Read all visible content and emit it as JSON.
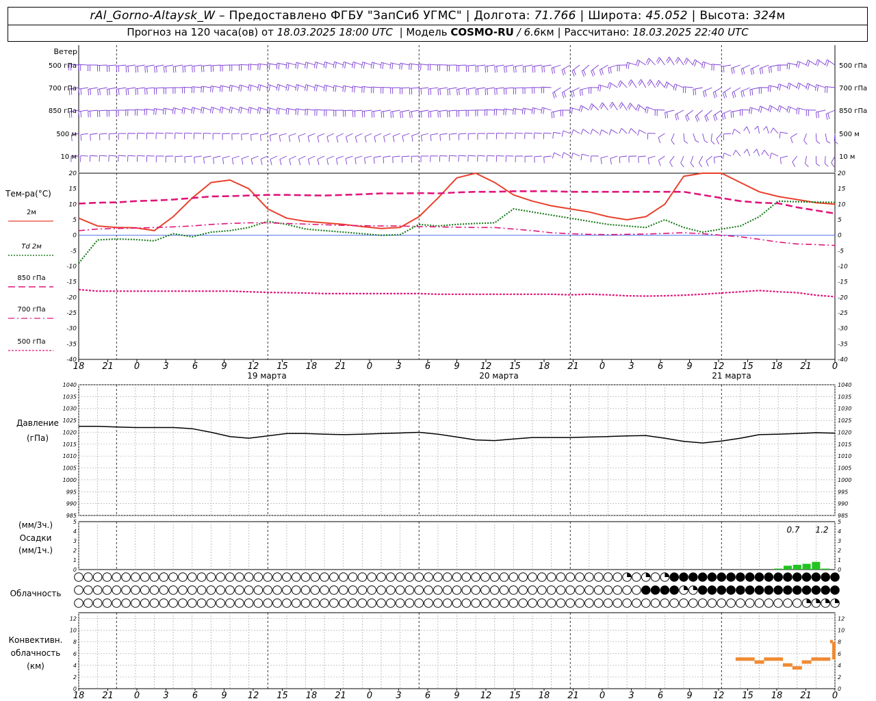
{
  "header": {
    "station": "rAl_Gorno-Altaysk_W",
    "dash": "–",
    "provider_label": "Предоставлено ФГБУ \"ЗапСиб УГМС\"",
    "lon_label": "Долгота:",
    "lon": "71.766",
    "lat_label": "Широта:",
    "lat": "45.052",
    "alt_label": "Высота:",
    "alt": "324",
    "alt_unit": "м",
    "sep": "|",
    "forecast_label": "Прогноз на 120 часа(ов) от",
    "forecast_time": "18.03.2025 18:00 UTC",
    "model_label": "Модель",
    "model_name": "COSMO-RU",
    "model_slash": "/",
    "model_res": "6.6",
    "model_res_unit": "км",
    "calc_label": "Рассчитано:",
    "calc_time": "18.03.2025 22:40 UTC"
  },
  "wind_panel": {
    "title": "Ветер",
    "levels": [
      "500 гПа",
      "700 гПа",
      "850 гПа",
      "500  м",
      "10  м"
    ]
  },
  "temp_panel": {
    "title": "Тем-ра(°C)",
    "legend": [
      {
        "label": "2м",
        "color": "#e8402a"
      },
      {
        "label": "Td  2м",
        "color": "#1a7a1a"
      },
      {
        "label": "850 гПа",
        "color": "#e0147a"
      },
      {
        "label": "700 гПа",
        "color": "#e0147a"
      },
      {
        "label": "500 гПа",
        "color": "#e0147a"
      }
    ]
  },
  "pressure_panel": {
    "title": "Давление",
    "unit": "(гПа)"
  },
  "precip_panel": {
    "unit_top": "(мм/3ч.)",
    "title": "Осадки",
    "unit_bottom": "(мм/1ч.)"
  },
  "cloud_panel": {
    "title": "Облачность"
  },
  "conv_panel": {
    "title_1": "Конвективн.",
    "title_2": "облачность",
    "unit": "(км)"
  },
  "time_axis": {
    "hour_labels": [
      "18",
      "21",
      "0",
      "3",
      "6",
      "9",
      "12",
      "15",
      "18",
      "21",
      "0",
      "3",
      "6",
      "9",
      "12",
      "15",
      "18",
      "21",
      "0",
      "3",
      "6",
      "9",
      "12",
      "15",
      "18",
      "21",
      "0"
    ],
    "day_labels": [
      "19 марта",
      "20 марта",
      "21 марта"
    ]
  },
  "chart_data": [
    {
      "type": "line",
      "title": "Тем-ра(°C)",
      "x_hours": [
        0,
        3,
        6,
        9,
        12,
        15,
        18,
        21,
        24,
        27,
        30,
        33,
        36,
        39,
        42,
        45,
        48,
        51,
        54,
        57,
        60,
        63,
        66,
        69,
        72,
        75,
        78,
        81,
        84,
        87,
        90,
        93,
        96,
        99,
        102,
        105,
        108,
        111,
        114,
        117,
        120
      ],
      "ylim": [
        -40,
        20
      ],
      "yticks": [
        20,
        15,
        10,
        5,
        0,
        -5,
        -10,
        -15,
        -20,
        -25,
        -30,
        -35,
        -40
      ],
      "series": [
        {
          "name": "2м",
          "color": "#e8402a",
          "values": [
            5.5,
            3,
            2.5,
            2.4,
            1.5,
            6,
            12,
            17,
            17.8,
            15,
            8.5,
            5.5,
            4.5,
            4,
            3.5,
            2.8,
            2.2,
            2.5,
            6,
            12,
            18.5,
            20.5,
            17,
            13,
            11,
            9.5,
            8.5,
            7.5,
            6,
            5,
            6,
            10,
            19,
            23,
            21,
            17,
            14,
            12.5,
            11.5,
            10.5,
            10
          ]
        },
        {
          "name": "Td  2м",
          "color": "#1a7a1a",
          "values": [
            -9,
            -1.5,
            -1.2,
            -1.4,
            -1.8,
            0.5,
            -0.5,
            1,
            1.5,
            2.5,
            4.5,
            3.5,
            2,
            1.5,
            1,
            0.5,
            0,
            0.2,
            3.5,
            3,
            3.5,
            3.8,
            4,
            8.5,
            7.5,
            6.5,
            5.5,
            4.5,
            3.5,
            3,
            2.5,
            5,
            2.5,
            1,
            2,
            3,
            6,
            11,
            10.8,
            10.7,
            10.6
          ]
        },
        {
          "name": "850 гПа",
          "color": "#e0147a",
          "values": [
            10.2,
            10.5,
            10.6,
            11,
            11.2,
            11.5,
            12,
            12.5,
            12.6,
            12.8,
            13,
            13,
            12.9,
            12.8,
            13,
            13.2,
            13.5,
            13.5,
            13.6,
            13.5,
            13.8,
            14,
            14,
            14.2,
            14.2,
            14.2,
            14,
            14,
            14,
            14,
            14,
            14,
            14,
            13,
            12,
            11,
            10.5,
            10.3,
            9,
            8,
            7
          ]
        },
        {
          "name": "700 гПа",
          "color": "#e0147a",
          "values": [
            1.5,
            2,
            2.2,
            2.3,
            2.5,
            2.7,
            3,
            3.5,
            3.8,
            4,
            4,
            3.8,
            3.6,
            3.4,
            3.2,
            3.1,
            3,
            3,
            2.8,
            2.7,
            2.6,
            2.5,
            2.5,
            2,
            1.5,
            0.8,
            0.5,
            0.3,
            0.2,
            0.3,
            0.4,
            0.6,
            0.8,
            0.5,
            0,
            -0.5,
            -1.3,
            -2.2,
            -2.8,
            -3,
            -3.3
          ]
        },
        {
          "name": "500 гПа",
          "color": "#e0147a",
          "values": [
            -17.5,
            -18,
            -18,
            -18,
            -18,
            -18,
            -18,
            -18,
            -18,
            -18.2,
            -18.4,
            -18.5,
            -18.6,
            -18.8,
            -18.8,
            -18.8,
            -18.8,
            -18.8,
            -18.8,
            -19,
            -19,
            -19,
            -19,
            -19,
            -19,
            -19,
            -19.2,
            -19,
            -19.2,
            -19.5,
            -19.6,
            -19.5,
            -19.3,
            -19,
            -18.6,
            -18.2,
            -17.8,
            -18.2,
            -18.5,
            -19.3,
            -19.8
          ]
        }
      ]
    },
    {
      "type": "line",
      "title": "Давление",
      "ylabel": "(гПа)",
      "ylim": [
        985,
        1040
      ],
      "yticks": [
        1040,
        1035,
        1030,
        1025,
        1020,
        1015,
        1010,
        1005,
        1000,
        995,
        990,
        985
      ],
      "x_hours": [
        0,
        3,
        6,
        9,
        12,
        15,
        18,
        21,
        24,
        27,
        30,
        33,
        36,
        39,
        42,
        45,
        48,
        51,
        54,
        57,
        60,
        63,
        66,
        69,
        72,
        75,
        78,
        81,
        84,
        87,
        90,
        93,
        96,
        99,
        102,
        105,
        108,
        111,
        114,
        117,
        120
      ],
      "values": [
        1022.5,
        1022.5,
        1022.2,
        1022,
        1022,
        1022,
        1021.5,
        1020,
        1018.2,
        1017.5,
        1018.5,
        1019.5,
        1019.5,
        1019.2,
        1019,
        1019.2,
        1019.5,
        1019.7,
        1020,
        1019.2,
        1018,
        1016.8,
        1016.5,
        1017.2,
        1017.8,
        1017.8,
        1017.8,
        1018,
        1018.2,
        1018.5,
        1018.6,
        1017.5,
        1016.2,
        1015.5,
        1016.3,
        1017.5,
        1019,
        1019.2,
        1019.5,
        1019.8,
        1019.6
      ]
    },
    {
      "type": "bar",
      "title": "Осадки",
      "ylim": [
        0,
        5
      ],
      "yticks": [
        0,
        1,
        2,
        3,
        4,
        5
      ],
      "annotations": [
        "0.7",
        "1.2"
      ],
      "hour_bins": [
        {
          "h": 111,
          "v": 0.1
        },
        {
          "h": 112.5,
          "v": 0.4
        },
        {
          "h": 114,
          "v": 0.5
        },
        {
          "h": 115.5,
          "v": 0.6
        },
        {
          "h": 117,
          "v": 0.8
        },
        {
          "h": 118.5,
          "v": 0.1
        }
      ]
    },
    {
      "type": "table",
      "title": "Облачность",
      "rows": 3,
      "step_hours": 1.5,
      "upper_dark_from_hour": 94,
      "middle_dark_from_hour": 90,
      "lower_partial_from_hour": 115
    },
    {
      "type": "bar",
      "title": "Конвективн. облачность",
      "ylabel": "(км)",
      "ylim": [
        0,
        13
      ],
      "yticks": [
        0,
        2,
        4,
        6,
        8,
        10,
        12
      ],
      "hour_bins": [
        {
          "h": 105,
          "v": 5
        },
        {
          "h": 106.5,
          "v": 5
        },
        {
          "h": 108,
          "v": 4.5
        },
        {
          "h": 109.5,
          "v": 5
        },
        {
          "h": 111,
          "v": 5
        },
        {
          "h": 112.5,
          "v": 4
        },
        {
          "h": 114,
          "v": 3.5
        },
        {
          "h": 115.5,
          "v": 4.5
        },
        {
          "h": 117,
          "v": 5
        },
        {
          "h": 118.5,
          "v": 5
        },
        {
          "h": 120,
          "v": 8
        }
      ]
    }
  ]
}
